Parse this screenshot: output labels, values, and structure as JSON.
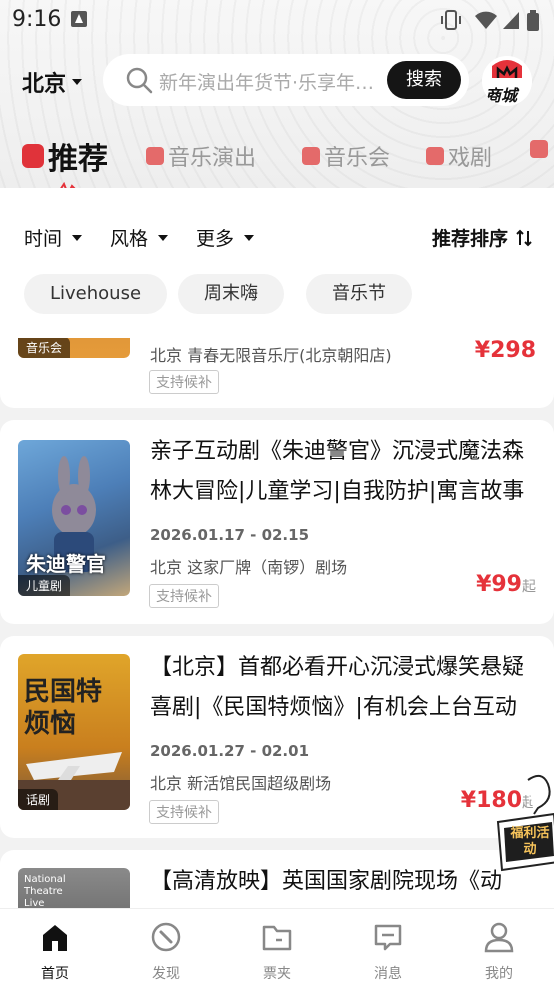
{
  "status_bar": {
    "time": "9:16"
  },
  "header": {
    "city": "北京",
    "search_placeholder": "新年演出年货节·乐享年终狂欢",
    "search_button": "搜索",
    "mall_label": "商城"
  },
  "tabs": [
    {
      "label": "推荐",
      "active": true
    },
    {
      "label": "音乐演出"
    },
    {
      "label": "音乐会"
    },
    {
      "label": "戏剧"
    }
  ],
  "filters": {
    "time": "时间",
    "style": "风格",
    "more": "更多",
    "sort": "推荐排序",
    "chips": [
      "Livehouse",
      "周末嗨",
      "音乐节"
    ]
  },
  "events": [
    {
      "tag": "音乐会",
      "title": "",
      "date": "",
      "venue": "北京 青春无限音乐厅(北京朝阳店)",
      "badge": "支持候补",
      "price": "¥298",
      "price_suffix": ""
    },
    {
      "tag": "儿童剧",
      "title": "亲子互动剧《朱迪警官》沉浸式魔法森林大冒险|儿童学习|自我防护|寓言故事",
      "date": "2026.01.17 - 02.15",
      "venue": "北京 这家厂牌（南锣）剧场",
      "badge": "支持候补",
      "price": "¥99",
      "price_suffix": "起",
      "poster_text": "朱迪警官"
    },
    {
      "tag": "话剧",
      "title": "【北京】首都必看开心沉浸式爆笑悬疑喜剧|《民国特烦恼》|有机会上台互动",
      "date": "2026.01.27 - 02.01",
      "venue": "北京 新活馆民国超级剧场",
      "badge": "支持候补",
      "price": "¥180",
      "price_suffix": "起",
      "poster_text": "民国特烦恼"
    },
    {
      "tag": "",
      "title": "【高清放映】英国国家剧院现场《动",
      "poster_text": "National Theatre Live"
    }
  ],
  "promo": {
    "label": "福利活动"
  },
  "bottom_nav": [
    {
      "label": "首页",
      "active": true
    },
    {
      "label": "发现"
    },
    {
      "label": "票夹"
    },
    {
      "label": "消息"
    },
    {
      "label": "我的"
    }
  ],
  "colors": {
    "accent": "#e5323a",
    "dark": "#151515"
  }
}
